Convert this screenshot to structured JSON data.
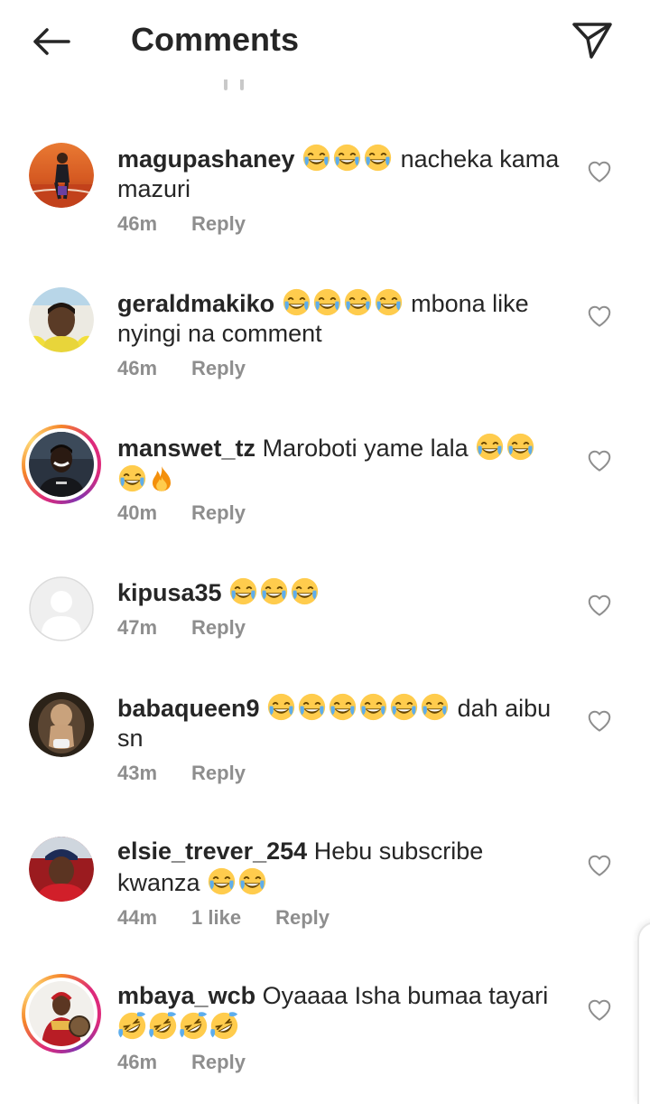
{
  "header": {
    "title": "Comments",
    "back_icon": "arrow-left-icon",
    "share_icon": "paper-plane-icon"
  },
  "colors": {
    "text": "#262626",
    "secondary": "#8e8e8e",
    "story_ring_start": "#f58529",
    "story_ring_end": "#dd2a7b"
  },
  "comments": [
    {
      "username": "magupashaney",
      "text_before": "",
      "emojis_inline": 3,
      "text": "nacheka kama mazuri",
      "time": "46m",
      "likes": "",
      "reply": "Reply"
    },
    {
      "username": "geraldmakiko",
      "emojis_inline": 4,
      "text": "mbona like nyingi na comment",
      "time": "46m",
      "likes": "",
      "reply": "Reply"
    },
    {
      "username": "manswet_tz",
      "text": "Maroboti yame lala",
      "time": "40m",
      "likes": "",
      "reply": "Reply"
    },
    {
      "username": "kipusa35",
      "time": "47m",
      "likes": "",
      "reply": "Reply"
    },
    {
      "username": "babaqueen9",
      "text": "dah aibu sn",
      "time": "43m",
      "likes": "",
      "reply": "Reply"
    },
    {
      "username": "elsie_trever_254",
      "text": "Hebu subscribe kwanza",
      "time": "44m",
      "likes": "1 like",
      "reply": "Reply"
    },
    {
      "username": "mbaya_wcb",
      "text": "Oyaaaa Isha bumaa tayari",
      "time": "46m",
      "likes": "",
      "reply": "Reply"
    }
  ]
}
